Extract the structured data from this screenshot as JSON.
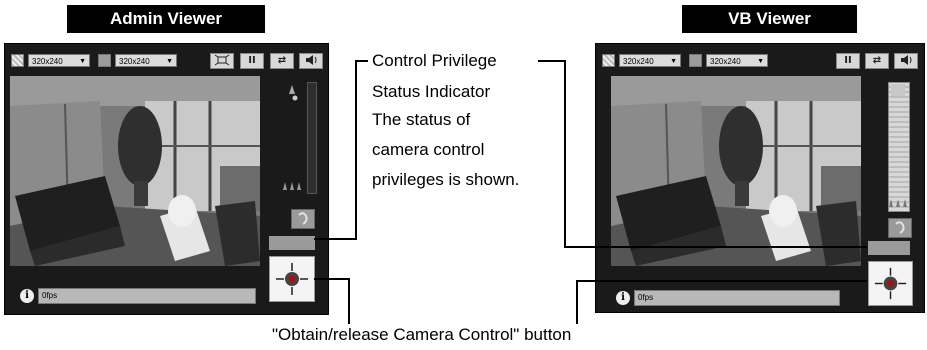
{
  "panels": {
    "admin": {
      "title": "Admin Viewer",
      "image_size_1": "320x240",
      "image_size_2": "320x240",
      "status_text": "0fps"
    },
    "vb": {
      "title": "VB Viewer",
      "image_size_1": "320x240",
      "image_size_2": "320x240",
      "status_text": "0fps"
    }
  },
  "callouts": {
    "privilege": {
      "lines": [
        "Control Privilege",
        "Status Indicator",
        "The status of",
        "camera control",
        "privileges is shown."
      ]
    },
    "button": "\"Obtain/release Camera Control\" button"
  },
  "icons": {
    "info": "i",
    "pause": "II",
    "swap": "⇄"
  },
  "colors": {
    "viewer_bg": "#1a1a1a",
    "title_bg": "#000000",
    "title_fg": "#ffffff"
  }
}
